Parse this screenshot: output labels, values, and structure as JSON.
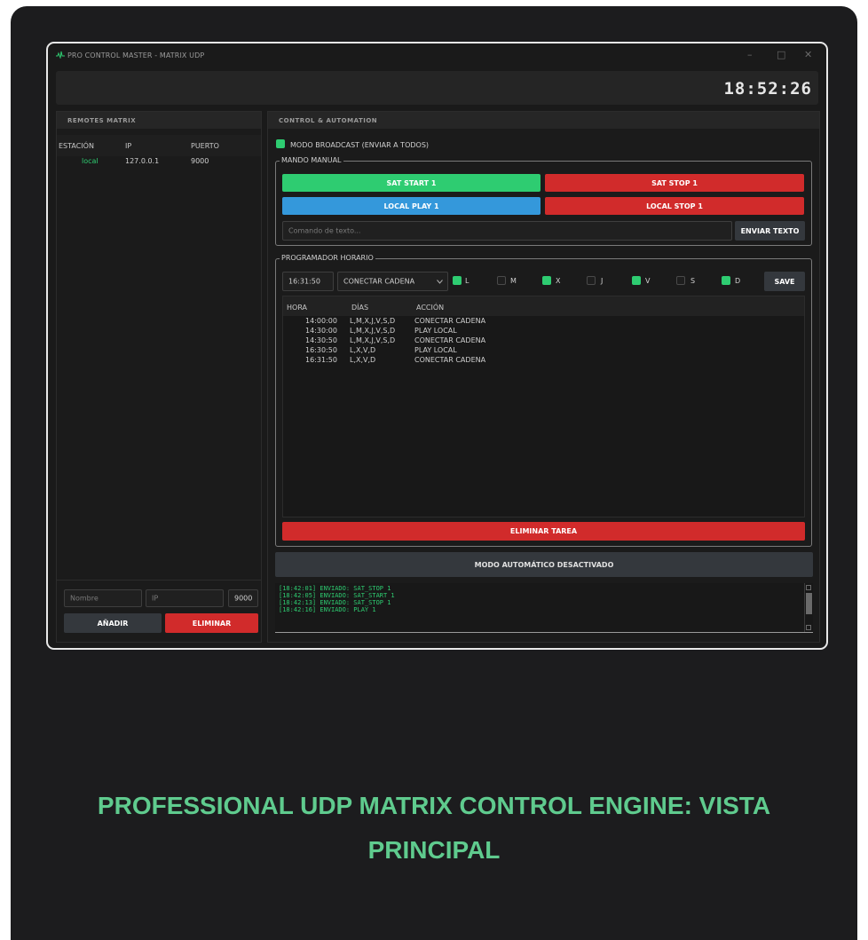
{
  "window": {
    "title": "PRO CONTROL MASTER - MATRIX UDP",
    "controls": [
      "–",
      "□",
      "✕"
    ]
  },
  "clock": "18:52:26",
  "remotes": {
    "title": "REMOTES MATRIX",
    "columns": [
      "ESTACIÓN",
      "IP",
      "PUERTO"
    ],
    "rows": [
      {
        "station": "local",
        "ip": "127.0.0.1",
        "port": "9000"
      }
    ],
    "name_placeholder": "Nombre",
    "ip_placeholder": "IP",
    "port_value": "9000",
    "add_label": "AÑADIR",
    "delete_label": "ELIMINAR"
  },
  "control": {
    "title": "CONTROL & AUTOMATION",
    "broadcast_label": "MODO BROADCAST (ENVIAR A TODOS)",
    "manual": {
      "label": "MANDO MANUAL",
      "sat_start": "SAT START 1",
      "sat_stop": "SAT STOP 1",
      "local_play": "LOCAL PLAY 1",
      "local_stop": "LOCAL STOP 1",
      "command_placeholder": "Comando de texto...",
      "send_label": "ENVIAR TEXTO"
    },
    "scheduler": {
      "label": "PROGRAMADOR HORARIO",
      "time_value": "16:31:50",
      "action_value": "CONECTAR CADENA",
      "days": [
        {
          "label": "L",
          "checked": true
        },
        {
          "label": "M",
          "checked": false
        },
        {
          "label": "X",
          "checked": true
        },
        {
          "label": "J",
          "checked": false
        },
        {
          "label": "V",
          "checked": true
        },
        {
          "label": "S",
          "checked": false
        },
        {
          "label": "D",
          "checked": true
        }
      ],
      "save_label": "SAVE",
      "columns": [
        "HORA",
        "DÍAS",
        "ACCIÓN"
      ],
      "tasks": [
        {
          "time": "14:00:00",
          "days": "L,M,X,J,V,S,D",
          "action": "CONECTAR CADENA"
        },
        {
          "time": "14:30:00",
          "days": "L,M,X,J,V,S,D",
          "action": "PLAY LOCAL"
        },
        {
          "time": "14:30:50",
          "days": "L,M,X,J,V,S,D",
          "action": "CONECTAR CADENA"
        },
        {
          "time": "16:30:50",
          "days": "L,X,V,D",
          "action": "PLAY LOCAL"
        },
        {
          "time": "16:31:50",
          "days": "L,X,V,D",
          "action": "CONECTAR CADENA"
        }
      ],
      "delete_task_label": "ELIMINAR TAREA"
    },
    "auto_mode_label": "MODO AUTOMÁTICO DESACTIVADO",
    "log": [
      "[18:42:01] ENVIADO: SAT_STOP 1",
      "[18:42:05] ENVIADO: SAT_START 1",
      "[18:42:13] ENVIADO: SAT_STOP 1",
      "[18:42:16] ENVIADO: PLAY 1"
    ]
  },
  "caption": {
    "line1": "PROFESSIONAL UDP MATRIX CONTROL ENGINE: VISTA",
    "line2": "PRINCIPAL"
  },
  "colors": {
    "green": "#2ecc71",
    "red": "#d12b2b",
    "blue": "#3498db",
    "caption": "#5fcb8e"
  }
}
